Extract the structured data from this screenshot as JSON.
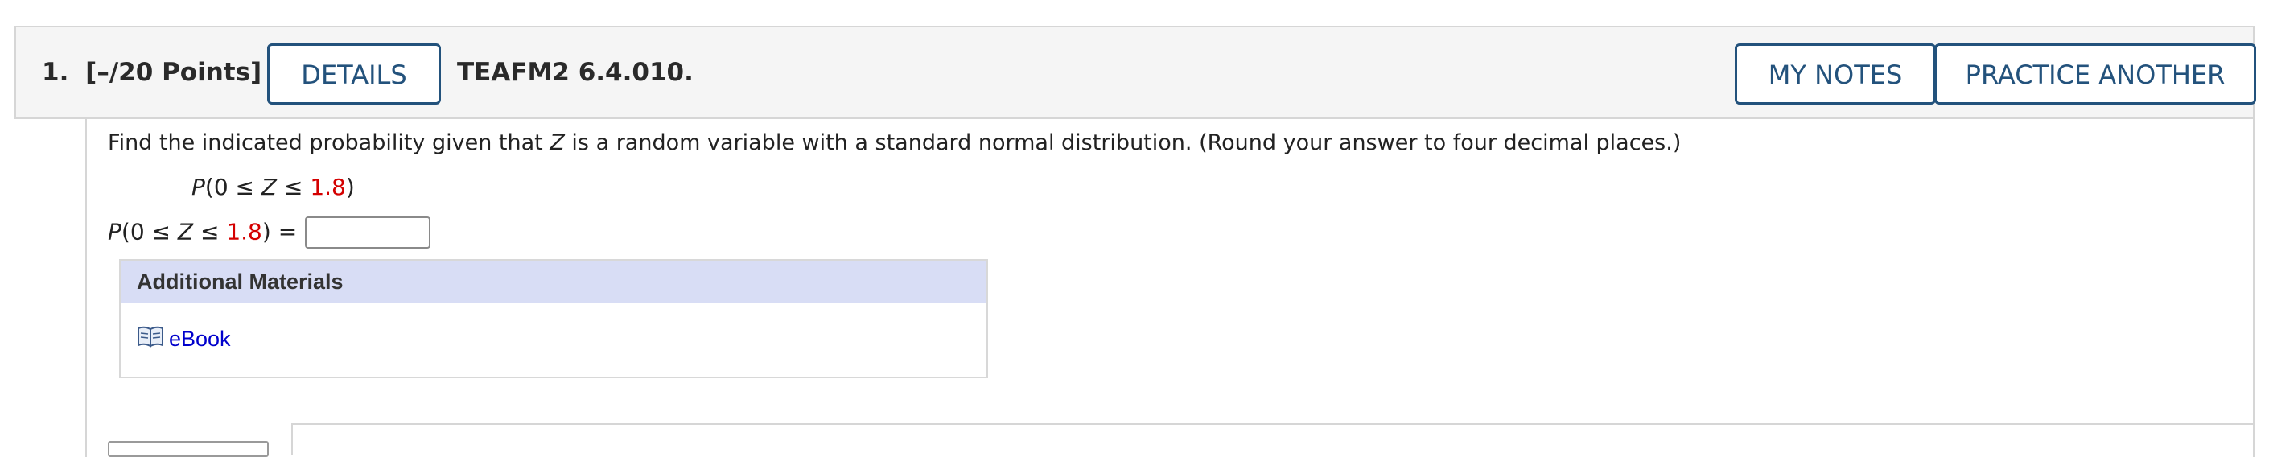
{
  "question": {
    "number_label": "1.",
    "points_label": "[–/20 Points]",
    "details_label": "DETAILS",
    "id_label": "TEAFM2 6.4.010.",
    "my_notes_label": "MY NOTES",
    "practice_label": "PRACTICE ANOTHER"
  },
  "body": {
    "prompt_prefix": "Find the indicated probability given that ",
    "prompt_var": "Z",
    "prompt_suffix": " is a random variable with a standard normal distribution. (Round your answer to four decimal places.)",
    "expr_open": "P",
    "expr_mid1": "(0 ≤ ",
    "expr_var": "Z",
    "expr_mid2": " ≤ ",
    "expr_value": "1.8",
    "expr_close": ")",
    "equals": " =",
    "answer_value": ""
  },
  "additional": {
    "title": "Additional Materials",
    "ebook_label": "eBook",
    "ebook_icon": "book-icon"
  },
  "colors": {
    "button_border": "#23527c",
    "highlight_value": "#d40000",
    "materials_header_bg": "#d8ddf5",
    "link": "#0000cc"
  }
}
